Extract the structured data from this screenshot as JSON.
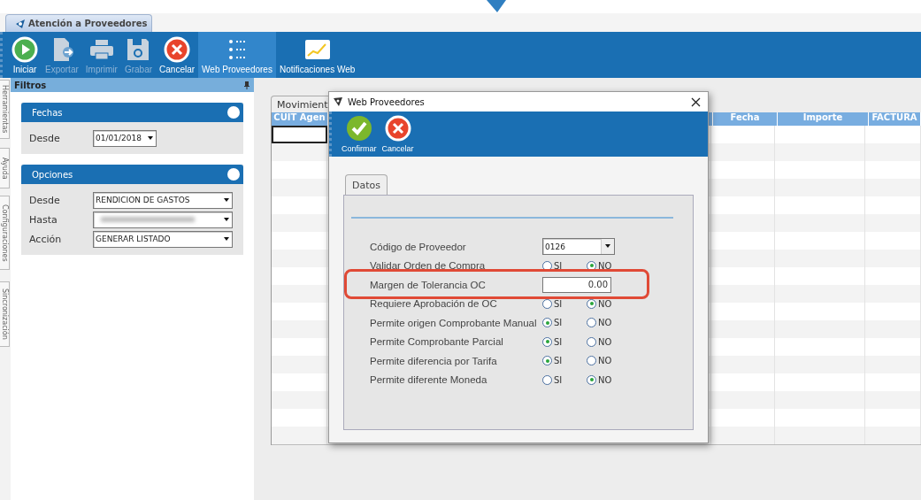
{
  "app_tab": {
    "title": "Atención a Proveedores"
  },
  "toolbar": [
    {
      "label": "Iniciar",
      "kind": "play",
      "disabled": false,
      "selected": false
    },
    {
      "label": "Exportar",
      "kind": "export",
      "disabled": true,
      "selected": false
    },
    {
      "label": "Imprimir",
      "kind": "print",
      "disabled": true,
      "selected": false
    },
    {
      "label": "Grabar",
      "kind": "save",
      "disabled": true,
      "selected": false
    },
    {
      "label": "Cancelar",
      "kind": "cancel",
      "disabled": false,
      "selected": false
    },
    {
      "label": "Web Proveedores",
      "kind": "list",
      "disabled": false,
      "selected": true
    },
    {
      "label": "Notificaciones Web",
      "kind": "chart",
      "disabled": false,
      "selected": false
    }
  ],
  "side_tabs": [
    "Herramientas",
    "Ayuda",
    "Configuraciones",
    "Sincronización"
  ],
  "filters": {
    "title": "Filtros",
    "sections": [
      {
        "title": "Fechas",
        "fields": [
          {
            "label": "Desde",
            "value": "01/01/2018",
            "kind": "date"
          }
        ]
      },
      {
        "title": "Opciones",
        "fields": [
          {
            "label": "Desde",
            "value": "RENDICION DE GASTOS",
            "kind": "combo"
          },
          {
            "label": "Hasta",
            "kind": "blurred"
          },
          {
            "label": "Acción",
            "value": "GENERAR LISTADO",
            "kind": "combo"
          }
        ]
      }
    ]
  },
  "main": {
    "tab": "Movimient",
    "columns": [
      "CUIT Agen",
      "Fecha",
      "Importe",
      "FACTURA"
    ]
  },
  "dialog": {
    "title": "Web Proveedores",
    "toolbar": [
      {
        "label": "Confirmar",
        "kind": "confirm"
      },
      {
        "label": "Cancelar",
        "kind": "cancel"
      }
    ],
    "tab": "Datos",
    "fields": [
      {
        "label": "Código de Proveedor",
        "kind": "combo",
        "value": "0126",
        "highlighted": false
      },
      {
        "label": "Validar Orden de Compra",
        "kind": "radio",
        "highlighted": false,
        "options": [
          {
            "label": "SI",
            "selected": false
          },
          {
            "label": "NO",
            "selected": true
          }
        ]
      },
      {
        "label": "Margen de Tolerancia OC",
        "kind": "number",
        "value": "0.00",
        "highlighted": true
      },
      {
        "label": "Requiere Aprobación de OC",
        "kind": "radio",
        "highlighted": false,
        "options": [
          {
            "label": "SI",
            "selected": false
          },
          {
            "label": "NO",
            "selected": true
          }
        ]
      },
      {
        "label": "Permite origen Comprobante Manual",
        "kind": "radio",
        "highlighted": false,
        "options": [
          {
            "label": "SI",
            "selected": true
          },
          {
            "label": "NO",
            "selected": false
          }
        ]
      },
      {
        "label": "Permite Comprobante Parcial",
        "kind": "radio",
        "highlighted": false,
        "options": [
          {
            "label": "SI",
            "selected": true
          },
          {
            "label": "NO",
            "selected": false
          }
        ]
      },
      {
        "label": "Permite diferencia por Tarifa",
        "kind": "radio",
        "highlighted": false,
        "options": [
          {
            "label": "SI",
            "selected": true
          },
          {
            "label": "NO",
            "selected": false
          }
        ]
      },
      {
        "label": "Permite diferente Moneda",
        "kind": "radio",
        "highlighted": false,
        "options": [
          {
            "label": "SI",
            "selected": false
          },
          {
            "label": "NO",
            "selected": true
          }
        ]
      }
    ]
  }
}
